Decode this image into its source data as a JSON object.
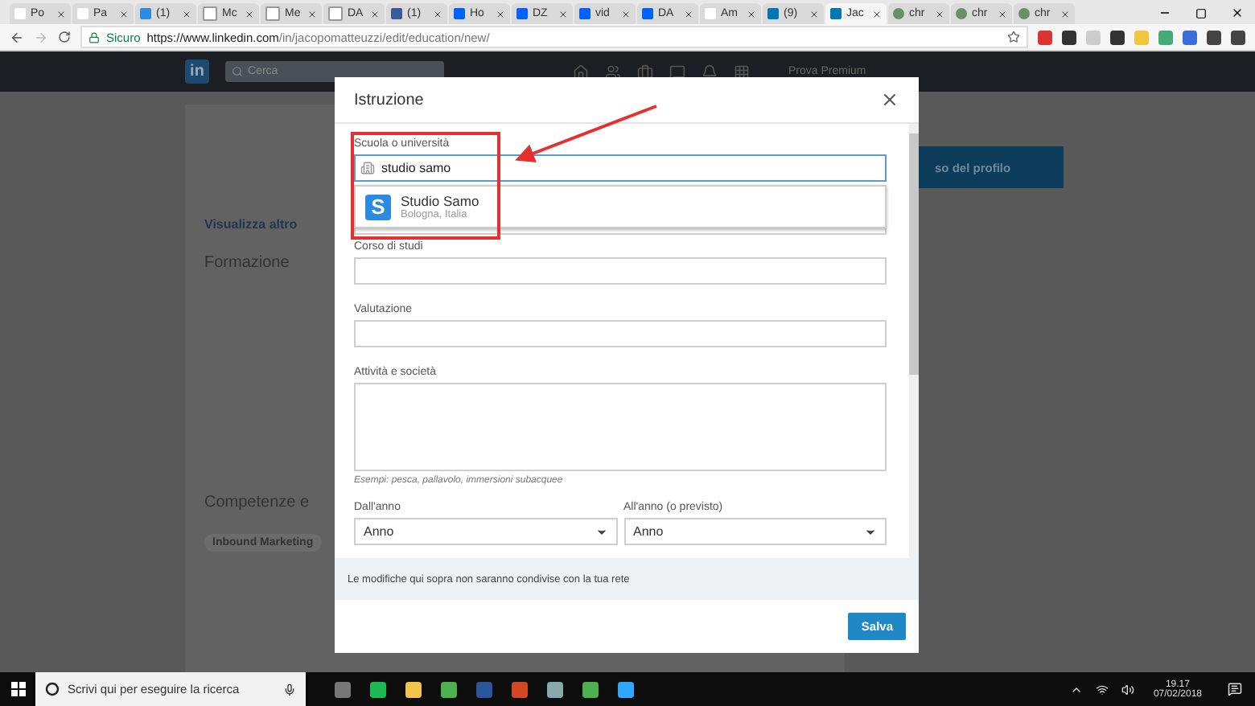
{
  "browser": {
    "tabs": [
      {
        "title": "Po",
        "kind": "gmail",
        "selected": false
      },
      {
        "title": "Pa",
        "kind": "gmail",
        "selected": false
      },
      {
        "title": "(1)",
        "kind": "s",
        "selected": false
      },
      {
        "title": "Mc",
        "kind": "doc",
        "selected": false
      },
      {
        "title": "Me",
        "kind": "doc",
        "selected": false
      },
      {
        "title": "DA",
        "kind": "doc",
        "selected": false
      },
      {
        "title": "(1)",
        "kind": "facebook",
        "selected": false
      },
      {
        "title": "Ho",
        "kind": "dropbox",
        "selected": false
      },
      {
        "title": "DZ",
        "kind": "dropbox",
        "selected": false
      },
      {
        "title": "vid",
        "kind": "dropbox",
        "selected": false
      },
      {
        "title": "DA",
        "kind": "dropbox",
        "selected": false
      },
      {
        "title": "Am",
        "kind": "amazon",
        "selected": false
      },
      {
        "title": "(9)",
        "kind": "linkedin",
        "selected": false
      },
      {
        "title": "Jac",
        "kind": "linkedin",
        "selected": true
      },
      {
        "title": "chr",
        "kind": "chrome",
        "selected": false
      },
      {
        "title": "chr",
        "kind": "chrome",
        "selected": false
      },
      {
        "title": "chr",
        "kind": "chrome",
        "selected": false
      }
    ],
    "security": "Sicuro",
    "url_host": "https://www.linkedin.com",
    "url_path": "/in/jacopomatteuzzi/edit/education/new/"
  },
  "background_page": {
    "logo": "in",
    "search_placeholder": "Cerca",
    "premium": "Prova Premium",
    "show_more": "Visualizza altro",
    "education_title": "Formazione",
    "skills_title": "Competenze e",
    "skill": "Inbound Marketing",
    "profile_button": "so del profilo"
  },
  "modal": {
    "title": "Istruzione",
    "fields": [
      {
        "kind": "school",
        "label": "Scuola o università",
        "value": "studio samo"
      },
      {
        "kind": "covered"
      },
      {
        "kind": "input",
        "label": "Corso di studi"
      },
      {
        "kind": "input",
        "label": "Valutazione"
      },
      {
        "kind": "textarea",
        "label": "Attività e società",
        "hint": "Esempi: pesca, pallavolo, immersioni subacquee"
      }
    ],
    "years": [
      {
        "label": "Dall'anno",
        "value": "Anno"
      },
      {
        "label": "All'anno (o previsto)",
        "value": "Anno"
      }
    ],
    "suggestion": {
      "letter": "S",
      "name": "Studio Samo",
      "place": "Bologna, Italia"
    },
    "note": "Le modifiche qui sopra non saranno condivise con la tua rete",
    "save": "Salva"
  },
  "taskbar": {
    "search_placeholder": "Scrivi qui per eseguire la ricerca",
    "time": "19.17",
    "date": "07/02/2018"
  }
}
